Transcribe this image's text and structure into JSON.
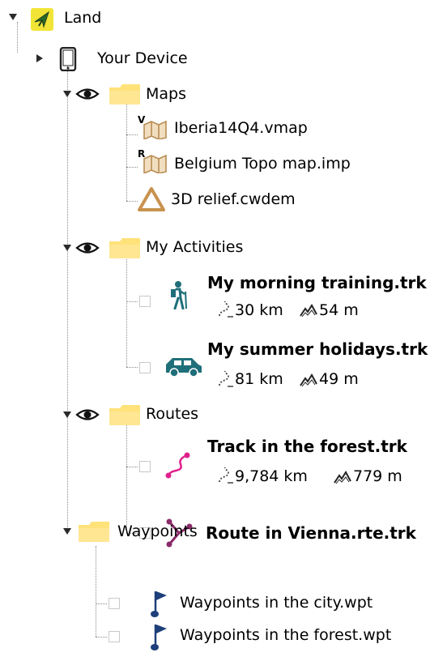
{
  "tree": {
    "root": {
      "label": "Land"
    },
    "device": {
      "label": "Your Device"
    },
    "maps": {
      "label": "Maps",
      "items": [
        {
          "label": "Iberia14Q4.vmap",
          "badge": "V"
        },
        {
          "label": "Belgium Topo map.imp",
          "badge": "R"
        },
        {
          "label": "3D relief.cwdem"
        }
      ]
    },
    "activities": {
      "label": "My Activities",
      "items": [
        {
          "label": "My morning training.trk",
          "distance": "30 km",
          "elevation": "54 m"
        },
        {
          "label": "My summer holidays.trk",
          "distance": "81 km",
          "elevation": "49 m"
        }
      ]
    },
    "routes": {
      "label": "Routes",
      "items": [
        {
          "label": "Track in the forest.trk",
          "distance": "9,784 km",
          "elevation": "779 m"
        },
        {
          "label": "Route in Vienna.rte.trk"
        }
      ]
    },
    "waypoints": {
      "label": "Waypoints",
      "items": [
        {
          "label": "Waypoints in the city.wpt"
        },
        {
          "label": "Waypoints in the forest.wpt"
        }
      ]
    }
  },
  "colors": {
    "folder": "#ffe27a",
    "map_icon": "#c8a26a",
    "track_pink": "#e0208c",
    "route_purple": "#8b2a6a",
    "teal": "#1f6f7a",
    "waypoint_blue": "#1d3f7a",
    "land_badge": "#f2e436"
  }
}
